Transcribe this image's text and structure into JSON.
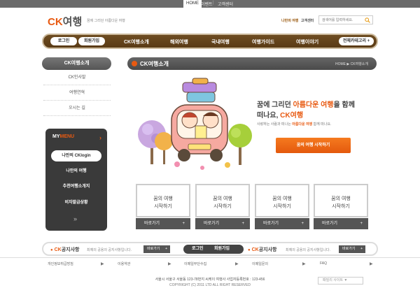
{
  "topbar": {
    "home": "HOME",
    "event": "이벤트",
    "sep": "|",
    "cs": "고객센터"
  },
  "header": {
    "logo_ck": "CK",
    "logo_rest": "여행",
    "tagline": "꿈에 그리던 아름다운 여행",
    "my_trip": "나만의 여행",
    "cs_center": "고객센터",
    "search_placeholder": "검색어를 입력하세요."
  },
  "nav": {
    "login": "로그인",
    "join": "회원가입",
    "items": [
      "CK여행소개",
      "해외여행",
      "국내여행",
      "여행가이드",
      "여행이야기"
    ],
    "all_categories": "전체카테고리 +"
  },
  "sidebar": {
    "title": "CK여행소개",
    "links": [
      "CK인사말",
      "여행연혁",
      "오시는 길"
    ],
    "mymenu": {
      "my": "MY",
      "menu": "MENU",
      "arrow": "›",
      "items": [
        "나만의 CKlogin",
        "나만의 여행",
        "추천여행소개지",
        "비자발급상황"
      ],
      "more": "»"
    }
  },
  "content": {
    "title": "CK여행소개",
    "breadcrumb": "HOME  ▶  CK여행소개",
    "hero": {
      "line1_a": "꿈에 그리던 ",
      "line1_hl": "아름다운 여행",
      "line1_b": "을 함께",
      "line2_a": "떠나요, ",
      "line2_hl": "CK여행",
      "sub_a": "사랑하는 사람과 떠나는 ",
      "sub_hl": "아름다운 여행",
      "sub_b": " 함께 떠나요.",
      "button": "꿈의 여행 시작하기"
    },
    "cards": [
      {
        "l1": "꿈의 여행",
        "l2": "시작하기",
        "go": "바로가기",
        "plus": "+"
      },
      {
        "l1": "꿈의 여행",
        "l2": "시작하기",
        "go": "바로가기",
        "plus": "+"
      },
      {
        "l1": "꿈의 여행",
        "l2": "시작하기",
        "go": "바로가기",
        "plus": "+"
      },
      {
        "l1": "꿈의 여행",
        "l2": "시작하기",
        "go": "바로가기",
        "plus": "+"
      }
    ]
  },
  "bottombar": {
    "notice_ck": "CK",
    "notice_rest": "공지사항",
    "notice_desc": "최예의 공용의 공지사항입니다.",
    "go": "바로가기",
    "plus": "+",
    "login": "로그인",
    "join": "회원가입"
  },
  "footer": {
    "links": [
      "개인정보취급방침",
      "이용약관",
      "이메일무단수집",
      "이메일문의",
      "FAQ"
    ],
    "family_site": "패밀리 사이트 ▼",
    "address": "서울시 서울구 서울동 123-78번지 씨케이 여행사 사업자등록번호 : 123-456",
    "copyright": "COPYRIGHT (C) 2011 LTD ALL RIGHT RESERVED"
  },
  "colors": {
    "accent": "#e85a12",
    "nav_brown": "#6e4d22",
    "dark": "#444444"
  }
}
